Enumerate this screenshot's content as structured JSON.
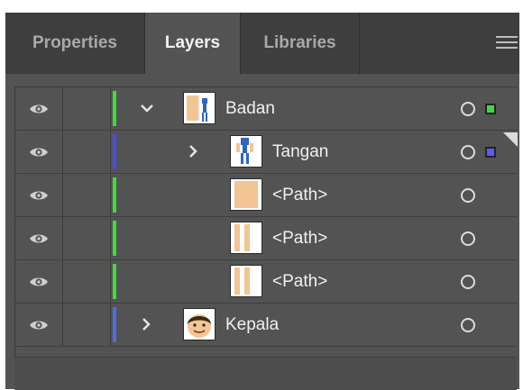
{
  "tabs": [
    {
      "label": "Properties",
      "active": false
    },
    {
      "label": "Layers",
      "active": true
    },
    {
      "label": "Libraries",
      "active": false
    }
  ],
  "layers": [
    {
      "name": "Badan",
      "indent": 0,
      "expanded": true,
      "has_children": true,
      "color": "#3ddc3d",
      "thumbnail": "body-figure-thumb",
      "selection_color": "#3ddc3d"
    },
    {
      "name": "Tangan",
      "indent": 1,
      "expanded": false,
      "has_children": true,
      "color": "#4a4ae6",
      "thumbnail": "hand-figure-thumb",
      "selection_color": "#5a5aff"
    },
    {
      "name": "<Path>",
      "indent": 2,
      "expanded": false,
      "has_children": false,
      "color": "#3ddc3d",
      "thumbnail": "path-thumb-solid"
    },
    {
      "name": "<Path>",
      "indent": 2,
      "expanded": false,
      "has_children": false,
      "color": "#3ddc3d",
      "thumbnail": "path-thumb-stripe"
    },
    {
      "name": "<Path>",
      "indent": 2,
      "expanded": false,
      "has_children": false,
      "color": "#3ddc3d",
      "thumbnail": "path-thumb-stripe"
    },
    {
      "name": "Kepala",
      "indent": 0,
      "expanded": false,
      "has_children": true,
      "color": "#4a6ee6",
      "thumbnail": "face-thumb"
    }
  ],
  "colors": {
    "skin": "#f2c592",
    "panel_bg": "#535353",
    "tabbar_bg": "#3e3e3e"
  }
}
